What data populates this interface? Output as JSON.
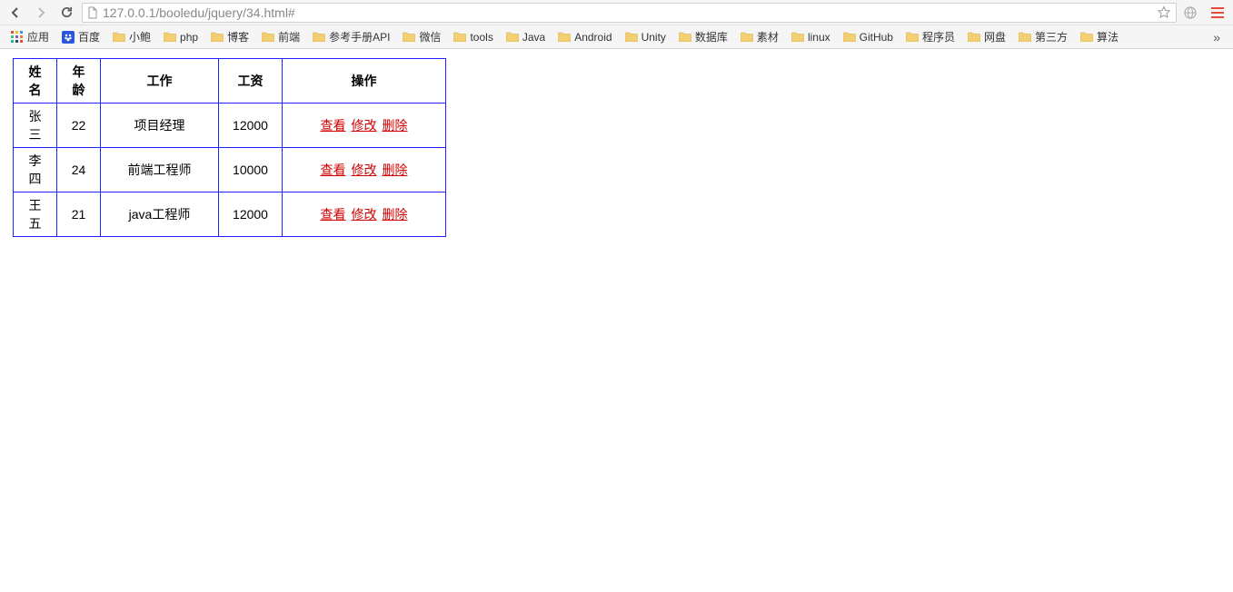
{
  "toolbar": {
    "url": "127.0.0.1/booledu/jquery/34.html#"
  },
  "bookmarks": {
    "apps_label": "应用",
    "baidu_label": "百度",
    "folders": [
      "小鲍",
      "php",
      "博客",
      "前端",
      "参考手册API",
      "微信",
      "tools",
      "Java",
      "Android",
      "Unity",
      "数据库",
      "素材",
      "linux",
      "GitHub",
      "程序员",
      "网盘",
      "第三方",
      "算法"
    ],
    "overflow": "»"
  },
  "table": {
    "headers": {
      "name": "姓名",
      "age": "年龄",
      "job": "工作",
      "salary": "工资",
      "actions": "操作"
    },
    "action_labels": {
      "view": "查看",
      "edit": "修改",
      "delete": "删除"
    },
    "rows": [
      {
        "name": "张三",
        "age": "22",
        "job": "项目经理",
        "salary": "12000"
      },
      {
        "name": "李四",
        "age": "24",
        "job": "前端工程师",
        "salary": "10000"
      },
      {
        "name": "王五",
        "age": "21",
        "job": "java工程师",
        "salary": "12000"
      }
    ]
  }
}
